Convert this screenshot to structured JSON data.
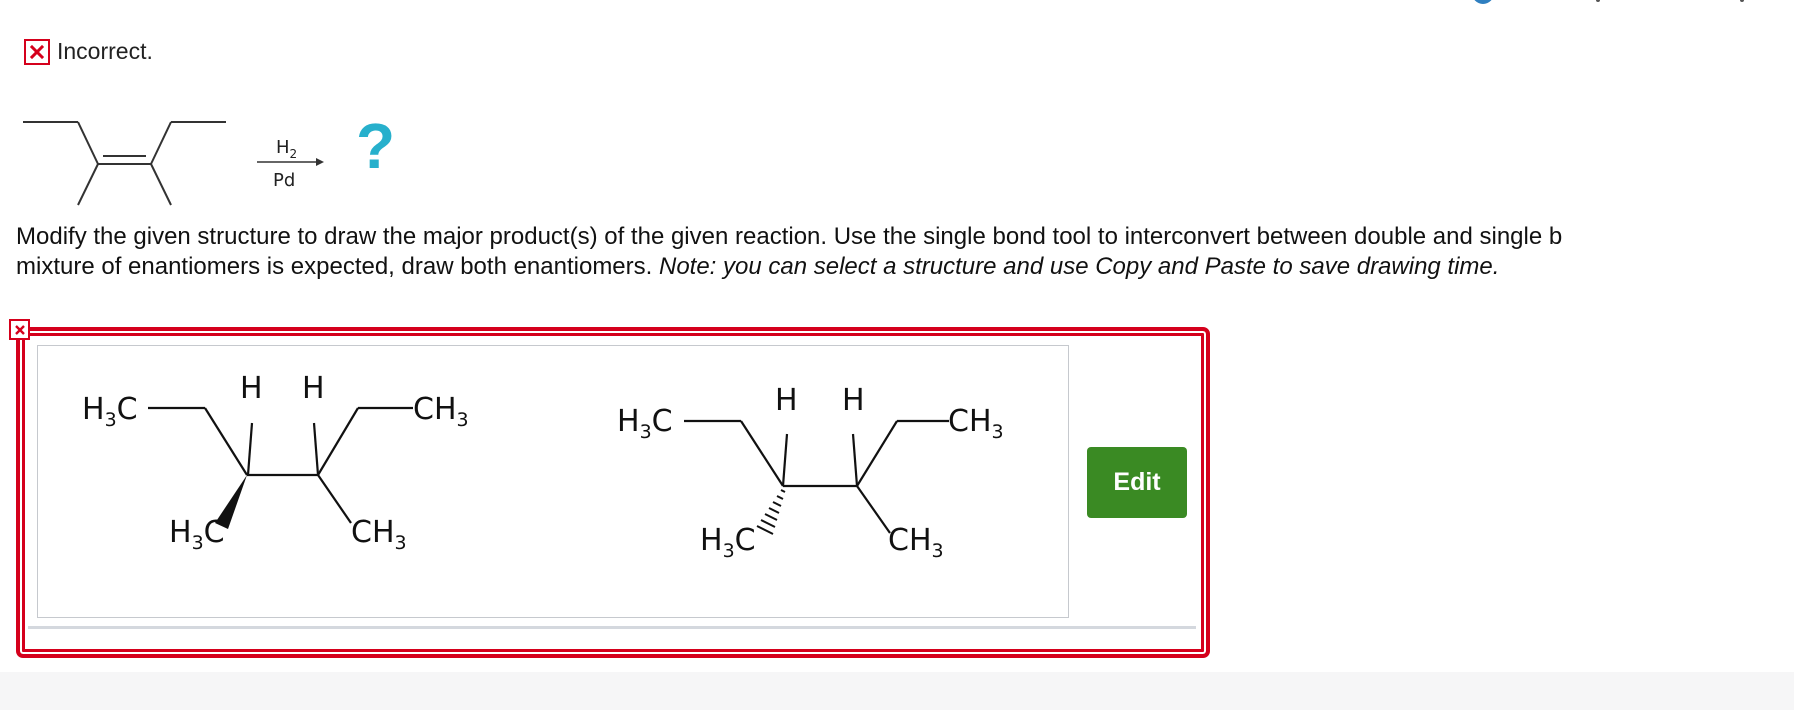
{
  "status": {
    "icon": "close-x-icon",
    "text": "Incorrect."
  },
  "reaction": {
    "reagent_top": "H",
    "reagent_top_sub": "2",
    "reagent_bottom": "Pd",
    "unknown_product": "?"
  },
  "instructions": {
    "line1": "Modify the given structure to draw the major product(s) of the given reaction. Use the single bond tool to interconvert between double and single b",
    "line2_normal": "mixture of enantiomers is expected, draw both enantiomers. ",
    "line2_italic": "Note: you can select a structure and use Copy and Paste to save drawing time."
  },
  "answer": {
    "status_icon": "close-x-icon",
    "edit_label": "Edit",
    "molecule_labels": {
      "methyl_left": "H",
      "methyl_left_sub": "3",
      "methyl_left_c": "C",
      "h_atom": "H",
      "methyl_right_c": "CH",
      "methyl_right_sub": "3"
    }
  },
  "colors": {
    "error_red": "#d5001c",
    "edit_green": "#3a8a23",
    "question_cyan": "#27b0cc"
  }
}
